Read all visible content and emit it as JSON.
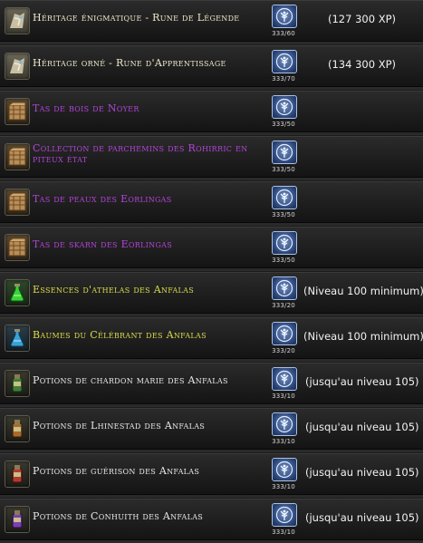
{
  "items": [
    {
      "name": "Héritage énigmatique - Rune de Légende",
      "color": "#ece7c8",
      "icon": "rune-icon",
      "cost": "333/60",
      "note": "(127 300 XP)"
    },
    {
      "name": "Héritage orné - Rune d'Apprentissage",
      "color": "#ece7c8",
      "icon": "rune-icon",
      "cost": "333/70",
      "note": "(134 300 XP)"
    },
    {
      "name": "Tas de bois de Noyer",
      "color": "#b344d8",
      "icon": "crate-icon",
      "cost": "333/50",
      "note": ""
    },
    {
      "name": "Collection de parchemins des Rohirric en piteux état",
      "color": "#b344d8",
      "icon": "crate-icon",
      "cost": "333/50",
      "note": ""
    },
    {
      "name": "Tas de peaux des Eorlingas",
      "color": "#b344d8",
      "icon": "crate-icon",
      "cost": "333/50",
      "note": ""
    },
    {
      "name": "Tas de skarn des Eorlingas",
      "color": "#b344d8",
      "icon": "crate-icon",
      "cost": "333/50",
      "note": ""
    },
    {
      "name": "Essences d'athelas des Anfalas",
      "color": "#d8dc4a",
      "icon": "green-potion-icon",
      "cost": "333/20",
      "note": "(Niveau 100 minimum)"
    },
    {
      "name": "Baumes du Célébrant des Anfalas",
      "color": "#d8dc4a",
      "icon": "blue-potion-icon",
      "cost": "333/20",
      "note": "(Niveau 100 minimum)"
    },
    {
      "name": "Potions de chardon marie des Anfalas",
      "color": "#e8e8e8",
      "icon": "green-flask-icon",
      "cost": "333/10",
      "note": "(jusqu'au niveau 105)"
    },
    {
      "name": "Potions de Lhinestad des Anfalas",
      "color": "#e8e8e8",
      "icon": "amber-flask-icon",
      "cost": "333/10",
      "note": "(jusqu'au niveau 105)"
    },
    {
      "name": "Potions de guérison des Anfalas",
      "color": "#e8e8e8",
      "icon": "red-flask-icon",
      "cost": "333/10",
      "note": "(jusqu'au niveau 105)"
    },
    {
      "name": "Potions de Conhuith des Anfalas",
      "color": "#e8e8e8",
      "icon": "purple-flask-icon",
      "cost": "333/10",
      "note": "(jusqu'au niveau 105)"
    }
  ],
  "token_icon": "white-tree-token-icon"
}
